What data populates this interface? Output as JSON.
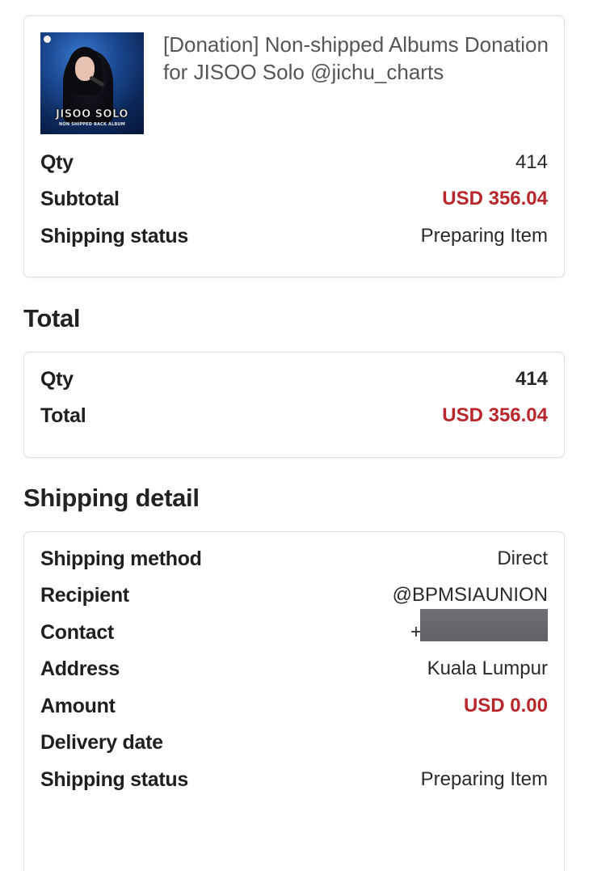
{
  "order_item": {
    "thumbnail": {
      "overlay_title": "JISOO SOLO",
      "overlay_subtitle": "NON SHIPPED BACK ALBUM"
    },
    "title": "[Donation] Non-shipped Albums Donation for JISOO Solo @jichu_charts",
    "rows": [
      {
        "label": "Qty",
        "value": "414"
      },
      {
        "label": "Subtotal",
        "value": "USD 356.04"
      },
      {
        "label": "Shipping status",
        "value": "Preparing Item"
      }
    ]
  },
  "total": {
    "heading": "Total",
    "rows": [
      {
        "label": "Qty",
        "value": "414"
      },
      {
        "label": "Total",
        "value": "USD 356.04"
      }
    ]
  },
  "shipping": {
    "heading": "Shipping detail",
    "rows": [
      {
        "label": "Shipping method",
        "value": "Direct"
      },
      {
        "label": "Recipient",
        "value": "@BPMSIAUNION"
      },
      {
        "label": "Contact",
        "value": "+"
      },
      {
        "label": "Address",
        "value": "Kuala Lumpur"
      },
      {
        "label": "Amount",
        "value": "USD 0.00"
      },
      {
        "label": "Delivery date",
        "value": ""
      },
      {
        "label": "Shipping status",
        "value": "Preparing Item"
      }
    ]
  },
  "colors": {
    "price": "#b8272b",
    "border": "#dedede",
    "redaction": "#67686c"
  }
}
